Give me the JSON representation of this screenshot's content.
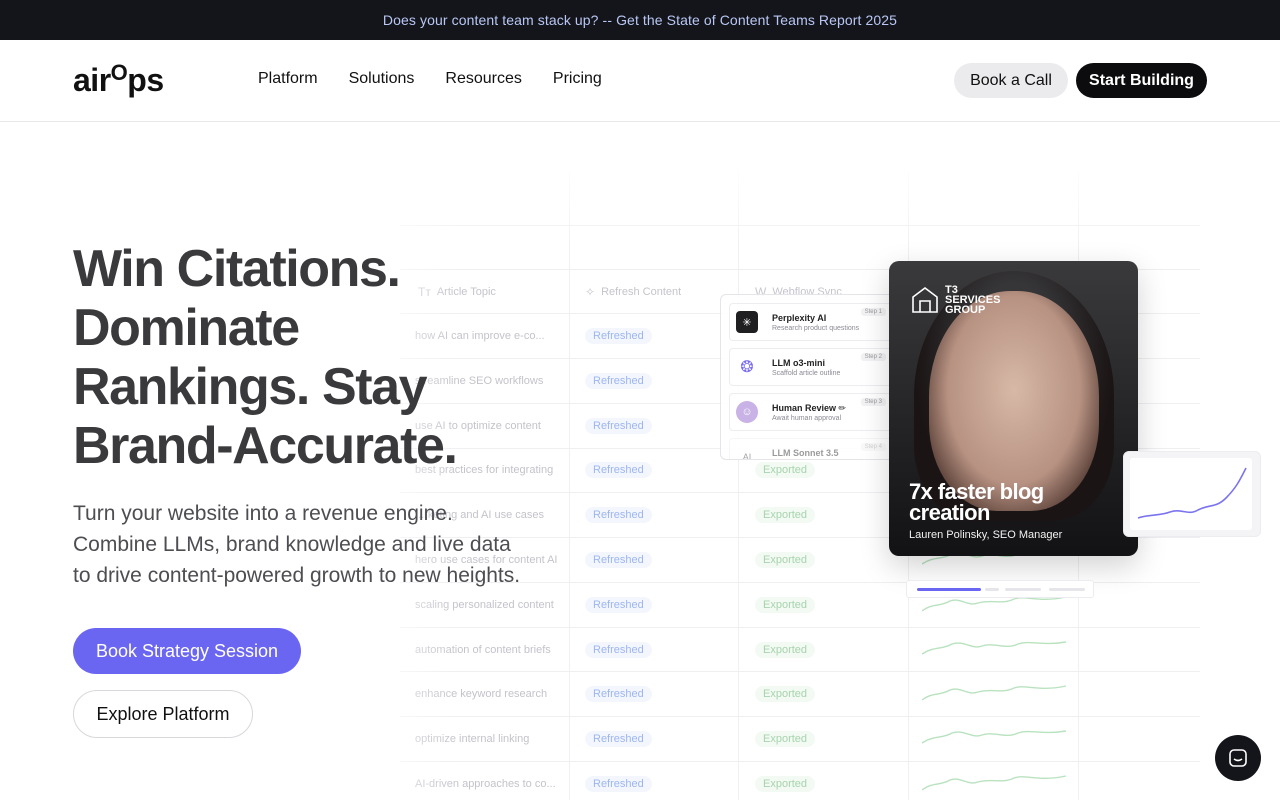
{
  "announcement": {
    "text": "Does your content team stack up? -- Get the State of Content Teams Report 2025"
  },
  "brand": {
    "logo_main": "air",
    "logo_o": "O",
    "logo_end": "ps",
    "accent": "#6b66f1"
  },
  "nav": {
    "items": [
      {
        "label": "Platform"
      },
      {
        "label": "Solutions"
      },
      {
        "label": "Resources"
      },
      {
        "label": "Pricing"
      }
    ],
    "book_call": "Book a Call",
    "start_building": "Start Building"
  },
  "hero": {
    "title_lines": [
      "Win Citations.",
      "Dominate",
      "Rankings. Stay",
      "Brand-Accurate."
    ],
    "subtitle_lines": [
      "Turn your website into a revenue engine.",
      "Combine LLMs, brand knowledge and live data",
      "to drive content-powered growth to new heights."
    ],
    "primary_cta": "Book Strategy Session",
    "secondary_cta": "Explore Platform"
  },
  "table": {
    "headers": [
      {
        "label": "Article Topic",
        "icon": "text-icon"
      },
      {
        "label": "Refresh Content",
        "icon": "sparkle-icon"
      },
      {
        "label": "Webflow Sync",
        "icon": "webflow-icon"
      }
    ],
    "rows": [
      {
        "topic": "how AI can improve e-co...",
        "refresh": "Refreshed",
        "sync": ""
      },
      {
        "topic": "streamline SEO workflows",
        "refresh": "Refreshed",
        "sync": ""
      },
      {
        "topic": "use AI to optimize content",
        "refresh": "Refreshed",
        "sync": ""
      },
      {
        "topic": "best practices for integrating",
        "refresh": "Refreshed",
        "sync": "Exported"
      },
      {
        "topic": "...rketing and AI use cases",
        "refresh": "Refreshed",
        "sync": "Exported"
      },
      {
        "topic": "hero use cases for content AI",
        "refresh": "Refreshed",
        "sync": "Exported"
      },
      {
        "topic": "scaling personalized content",
        "refresh": "Refreshed",
        "sync": "Exported"
      },
      {
        "topic": "automation of content briefs",
        "refresh": "Refreshed",
        "sync": "Exported"
      },
      {
        "topic": "enhance keyword research",
        "refresh": "Refreshed",
        "sync": "Exported"
      },
      {
        "topic": "optimize internal linking",
        "refresh": "Refreshed",
        "sync": "Exported"
      },
      {
        "topic": "AI-driven approaches to co...",
        "refresh": "Refreshed",
        "sync": "Exported"
      }
    ]
  },
  "workflow": {
    "steps": [
      {
        "name": "Perplexity AI",
        "desc": "Research product questions",
        "tag": "Step 1",
        "icon": "perplexity-icon"
      },
      {
        "name": "LLM o3-mini",
        "desc": "Scaffold article outline",
        "tag": "Step 2",
        "icon": "openai-icon"
      },
      {
        "name": "Human Review ✏",
        "desc": "Await human approval",
        "tag": "Step 3",
        "icon": "reviewer-avatar-icon"
      },
      {
        "name": "LLM Sonnet 3.5",
        "desc": "",
        "tag": "Step 4",
        "icon": "anthropic-icon"
      }
    ]
  },
  "testimonial": {
    "company_line1": "T3",
    "company_line2": "SERVICES",
    "company_line3": "GROUP",
    "headline": "7x faster blog creation",
    "person": "Lauren Polinsky, SEO Manager"
  },
  "carousel": {
    "active_index": 0,
    "count": 4
  }
}
